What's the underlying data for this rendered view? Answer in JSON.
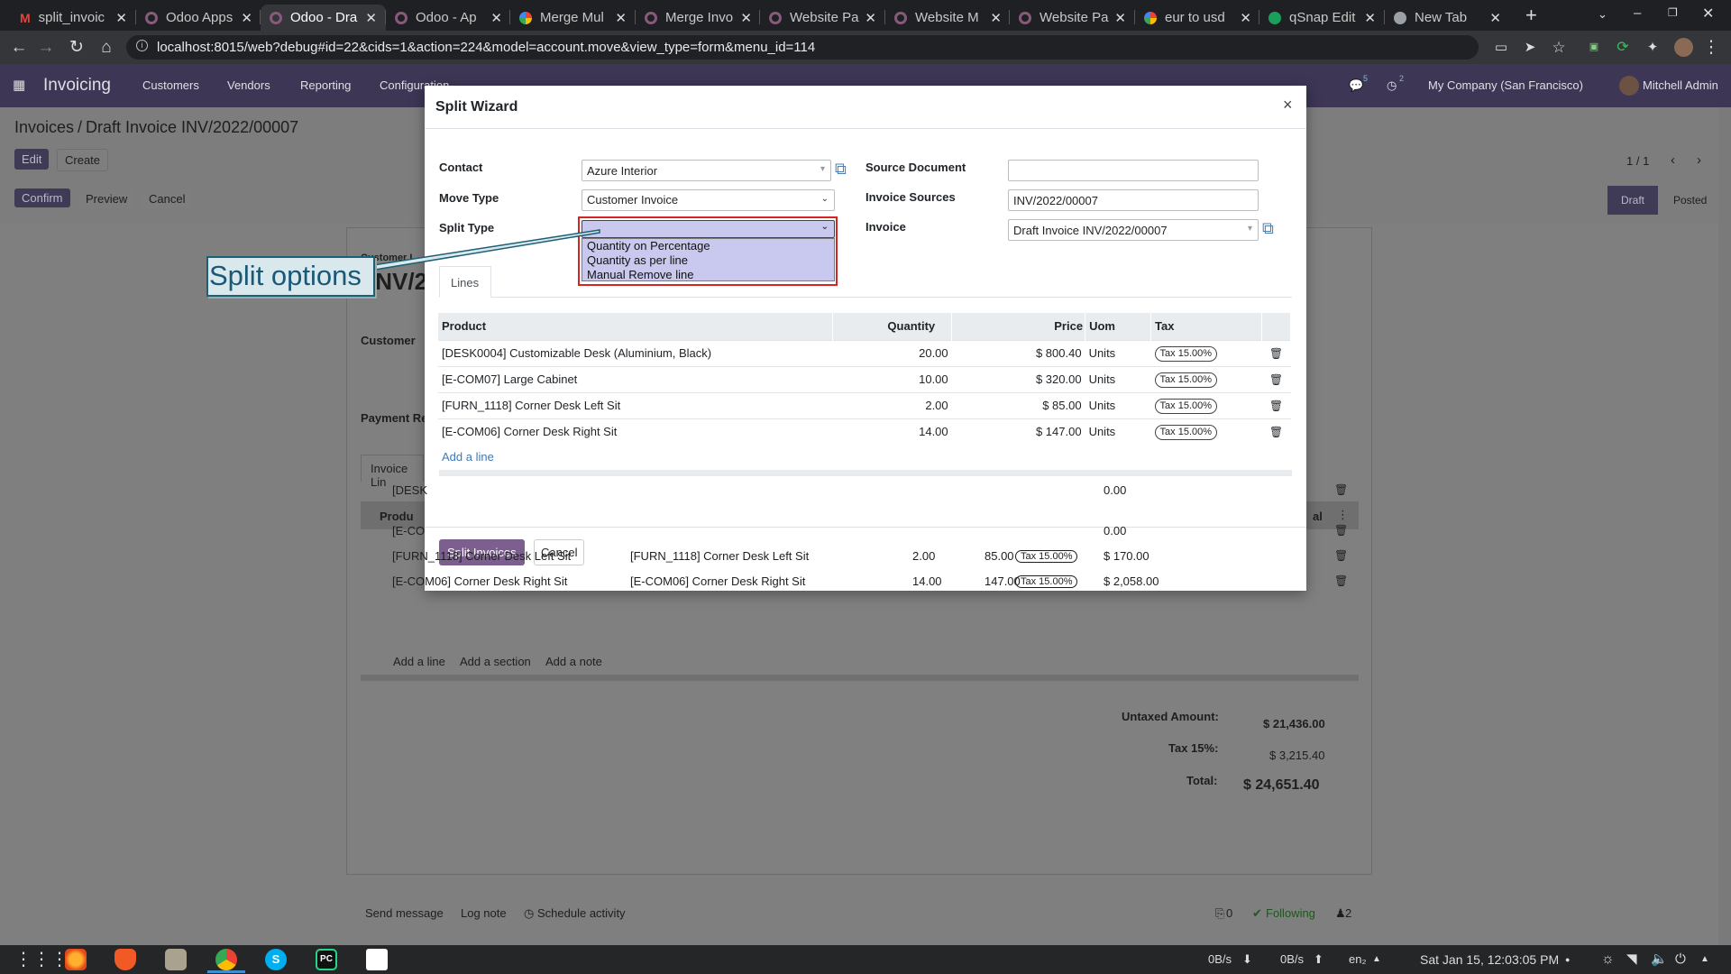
{
  "browser": {
    "tabs": [
      {
        "label": "split_invoic",
        "icon": "gmail-icon"
      },
      {
        "label": "Odoo Apps",
        "icon": "odoo-icon"
      },
      {
        "label": "Odoo - Dra",
        "icon": "odoo-icon",
        "active": true
      },
      {
        "label": "Odoo - Ap",
        "icon": "odoo-icon"
      },
      {
        "label": "Merge Mul",
        "icon": "google-icon"
      },
      {
        "label": "Merge Invo",
        "icon": "odoo-icon"
      },
      {
        "label": "Website Pa",
        "icon": "odoo-icon"
      },
      {
        "label": "Website M",
        "icon": "odoo-icon"
      },
      {
        "label": "Website Pa",
        "icon": "odoo-icon"
      },
      {
        "label": "eur to usd",
        "icon": "google-icon"
      },
      {
        "label": "qSnap Edit",
        "icon": "qsnap-icon"
      },
      {
        "label": "New Tab",
        "icon": "chrome-icon"
      }
    ],
    "url": "localhost:8015/web?debug#id=22&cids=1&action=224&model=account.move&view_type=form&menu_id=114"
  },
  "odoo_nav": {
    "app": "Invoicing",
    "menu": [
      "Customers",
      "Vendors",
      "Reporting",
      "Configuration"
    ],
    "msg_count": "5",
    "activity_count": "2",
    "company": "My Company (San Francisco)",
    "user": "Mitchell Admin"
  },
  "background": {
    "breadcrumb_root": "Invoices",
    "breadcrumb_current": "Draft Invoice INV/2022/00007",
    "edit": "Edit",
    "create": "Create",
    "confirm": "Confirm",
    "preview": "Preview",
    "cancel": "Cancel",
    "pager": "1 / 1",
    "status_draft": "Draft",
    "status_posted": "Posted",
    "customer_invoice": "Customer I",
    "inv_number": "INV/20",
    "customer_label": "Customer",
    "payment_label": "Payment Re",
    "invoice_lines_tab": "Invoice Lin",
    "col_product": "Produ",
    "col_total": "al",
    "rows": [
      {
        "product": "[DESK",
        "label": "",
        "qty": "",
        "price": "",
        "tax": "",
        "subtotal": "0.00"
      },
      {
        "product": "[E-CO",
        "label": "",
        "qty": "",
        "price": "",
        "tax": "",
        "subtotal": "0.00"
      },
      {
        "product": "[FURN_1118] Corner Desk Left Sit",
        "label": "[FURN_1118] Corner Desk Left Sit",
        "qty": "2.00",
        "price": "85.00",
        "tax": "Tax 15.00%",
        "subtotal": "$ 170.00"
      },
      {
        "product": "[E-COM06] Corner Desk Right Sit",
        "label": "[E-COM06] Corner Desk Right Sit",
        "qty": "14.00",
        "price": "147.00",
        "tax": "Tax 15.00%",
        "subtotal": "$ 2,058.00"
      }
    ],
    "add_line": "Add a line",
    "add_section": "Add a section",
    "add_note": "Add a note",
    "untaxed_label": "Untaxed Amount:",
    "untaxed_value": "$ 21,436.00",
    "tax_label": "Tax 15%:",
    "tax_value": "$ 3,215.40",
    "total_label": "Total:",
    "total_value": "$ 24,651.40",
    "send_message": "Send message",
    "log_note": "Log note",
    "schedule_activity": "Schedule activity",
    "attachments": "0",
    "following": "Following",
    "followers": "2"
  },
  "wizard": {
    "title": "Split Wizard",
    "contact_label": "Contact",
    "contact_value": "Azure Interior",
    "move_type_label": "Move Type",
    "move_type_value": "Customer Invoice",
    "split_type_label": "Split Type",
    "split_type_value": "",
    "split_options": [
      "Quantity on Percentage",
      "Quantity as per line",
      "Manual Remove line"
    ],
    "source_doc_label": "Source Document",
    "source_doc_value": "",
    "invoice_sources_label": "Invoice Sources",
    "invoice_sources_value": "INV/2022/00007",
    "invoice_label": "Invoice",
    "invoice_value": "Draft Invoice INV/2022/00007",
    "tab_lines": "Lines",
    "columns": [
      "Product",
      "Quantity",
      "Price",
      "Uom",
      "Tax"
    ],
    "lines": [
      {
        "product": "[DESK0004] Customizable Desk (Aluminium, Black)",
        "qty": "20.00",
        "price": "$ 800.40",
        "uom": "Units",
        "tax": "Tax 15.00%"
      },
      {
        "product": "[E-COM07] Large Cabinet",
        "qty": "10.00",
        "price": "$ 320.00",
        "uom": "Units",
        "tax": "Tax 15.00%"
      },
      {
        "product": "[FURN_1118] Corner Desk Left Sit",
        "qty": "2.00",
        "price": "$ 85.00",
        "uom": "Units",
        "tax": "Tax 15.00%"
      },
      {
        "product": "[E-COM06] Corner Desk Right Sit",
        "qty": "14.00",
        "price": "$ 147.00",
        "uom": "Units",
        "tax": "Tax 15.00%"
      }
    ],
    "add_line": "Add a line",
    "split_button": "Split Invoices",
    "cancel_button": "Cancel"
  },
  "annotation": {
    "callout": "Split options"
  },
  "taskbar": {
    "net_down": "0B/s",
    "net_up": "0B/s",
    "lang": "en₂",
    "clock": "Sat Jan 15, 12:03:05 PM"
  },
  "colors": {
    "odoo_primary": "#714b67",
    "accent_red": "#d42424",
    "callout_border": "#1d5f73"
  }
}
